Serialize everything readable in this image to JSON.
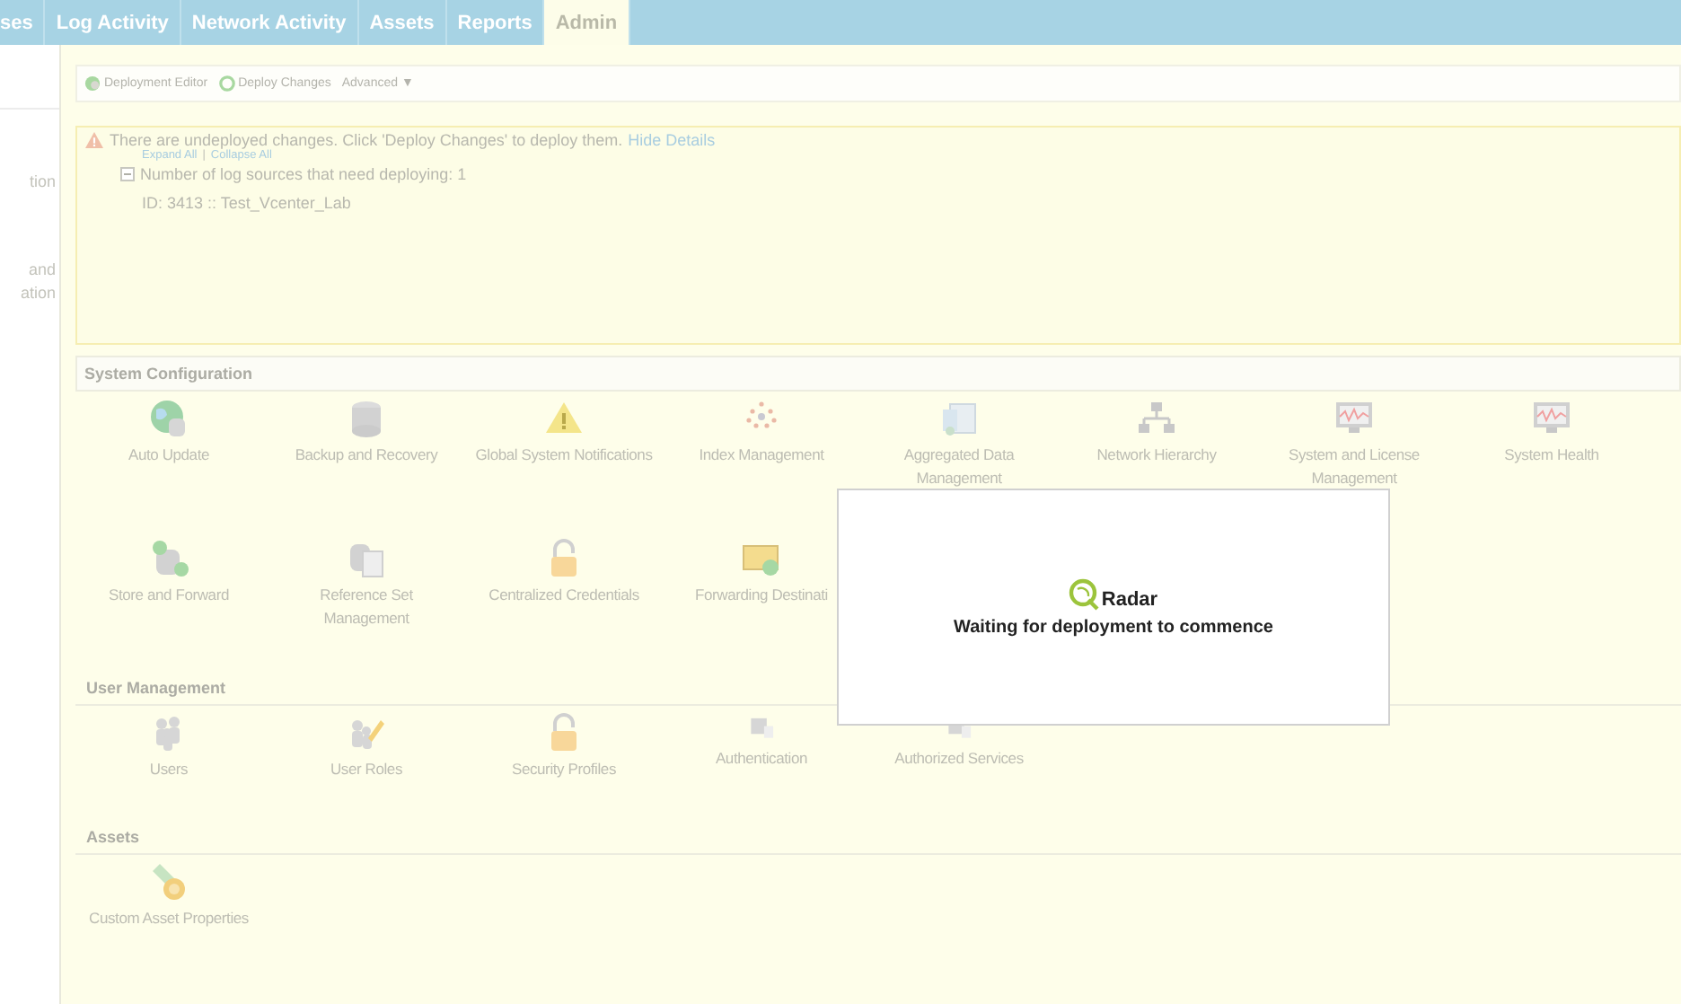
{
  "nav_tabs": [
    {
      "label": "ses",
      "selected": false
    },
    {
      "label": "Log Activity",
      "selected": false
    },
    {
      "label": "Network Activity",
      "selected": false
    },
    {
      "label": "Assets",
      "selected": false
    },
    {
      "label": "Reports",
      "selected": false
    },
    {
      "label": "Admin",
      "selected": true
    }
  ],
  "sidebar": {
    "fragments": [
      "tion",
      "and",
      "ation"
    ]
  },
  "toolbar": {
    "buttons": [
      "Deployment Editor",
      "Deploy Changes"
    ],
    "menu": "Advanced",
    "menu_arrow": "▼"
  },
  "notice": {
    "message": "There are undeployed changes. Click 'Deploy Changes' to deploy them.",
    "link": "Hide Details",
    "expand_all": "Expand All",
    "separator": "|",
    "collapse_all": "Collapse All",
    "group": {
      "label": "Number of log sources that need deploying: 1",
      "expanded": true,
      "children": [
        "ID: 3413 :: Test_Vcenter_Lab"
      ]
    }
  },
  "sections": [
    {
      "title": "System Configuration",
      "items": [
        "Auto Update",
        "Backup and Recovery",
        "Global System Notifications",
        "Index Management",
        "Aggregated Data Management",
        "Network Hierarchy",
        "System and License Management",
        "System Health",
        "Store and Forward",
        "Reference Set Management",
        "Centralized Credentials",
        "Forwarding Destinati"
      ]
    },
    {
      "title": "User Management",
      "items": [
        "Users",
        "User Roles",
        "Security Profiles",
        "Authentication",
        "Authorized Services"
      ]
    },
    {
      "title": "Assets",
      "items": [
        "Custom Asset Properties"
      ]
    }
  ],
  "dialog": {
    "brand": "Radar",
    "message": "Waiting for deployment to commence"
  }
}
